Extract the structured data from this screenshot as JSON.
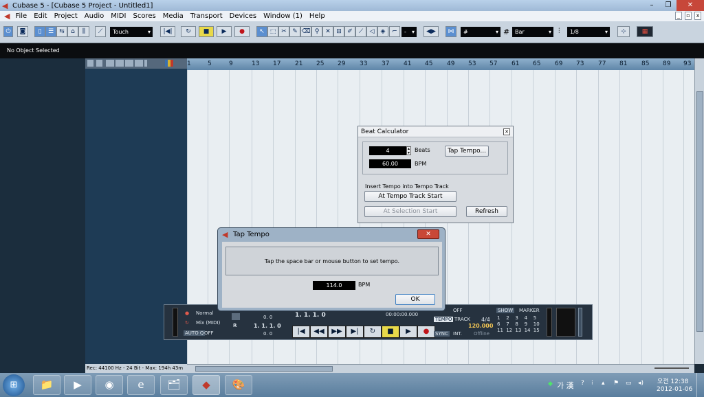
{
  "window": {
    "title": "Cubase 5 - [Cubase 5 Project - Untitled1]",
    "controls": [
      "–",
      "❐",
      "✕"
    ],
    "mdi_controls": [
      "_",
      "▫",
      "x"
    ]
  },
  "menu": [
    "File",
    "Edit",
    "Project",
    "Audio",
    "MIDI",
    "Scores",
    "Media",
    "Transport",
    "Devices",
    "Window (1)",
    "Help"
  ],
  "toolbar": {
    "automation_mode": "Touch",
    "nudge_value": "-",
    "grid_type": "Bar",
    "quantize": "1/8"
  },
  "info_line": "No Object Selected",
  "ruler": [
    "1",
    "5",
    "9",
    "13",
    "17",
    "21",
    "25",
    "29",
    "33",
    "37",
    "41",
    "45",
    "49",
    "53",
    "57",
    "61",
    "65",
    "69",
    "73",
    "77",
    "81",
    "85",
    "89",
    "93"
  ],
  "status_bar": "Rec: 44100 Hz - 24 Bit - Max: 194h 43m",
  "beat_calculator": {
    "title": "Beat Calculator",
    "beats_value": "4",
    "beats_label": "Beats",
    "bpm_value": "60.00",
    "bpm_label": "BPM",
    "tap_tempo_button": "Tap Tempo...",
    "insert_label": "Insert Tempo into Tempo Track",
    "at_track_start_button": "At Tempo Track Start",
    "at_selection_start_button": "At Selection Start",
    "refresh_button": "Refresh"
  },
  "tap_tempo": {
    "title": "Tap Tempo",
    "message": "Tap the space bar or mouse button to set tempo.",
    "bpm_value": "114.0",
    "bpm_label": "BPM",
    "ok_button": "OK"
  },
  "transport": {
    "mode_normal": "Normal",
    "mode_mix": "Mix (MIDI)",
    "auto_q": "AUTO Q",
    "auto_q_value": "OFF",
    "left_locator_time": "0. 0",
    "right_locator": "1. 1. 1. 0",
    "right_locator_time": "0. 0",
    "position": "1. 1. 1. 0",
    "position_time": "00:00:00.000",
    "sync_off": "OFF",
    "tempo_label": "TEMPO",
    "track_label": "TRACK",
    "signature": "4/4",
    "tempo_value": "120.000",
    "sync_label": "SYNC",
    "int_label": "INT.",
    "offline_label": "Offline",
    "show_label": "SHOW",
    "marker_label": "MARKER",
    "markers": [
      "1",
      "2",
      "3",
      "4",
      "5",
      "6",
      "7",
      "8",
      "9",
      "10",
      "11",
      "12",
      "13",
      "14",
      "15"
    ],
    "button_glyphs": [
      "|◀",
      "◀◀",
      "▶▶",
      "▶|",
      "↻",
      "■",
      "▶",
      "●"
    ]
  },
  "taskbar": {
    "apps": [
      "📁",
      "▶",
      "◉",
      "e",
      "🗂",
      "◆",
      "🎨"
    ],
    "ime": "가 漢",
    "time": "오전 12:38",
    "date": "2012-01-06"
  }
}
